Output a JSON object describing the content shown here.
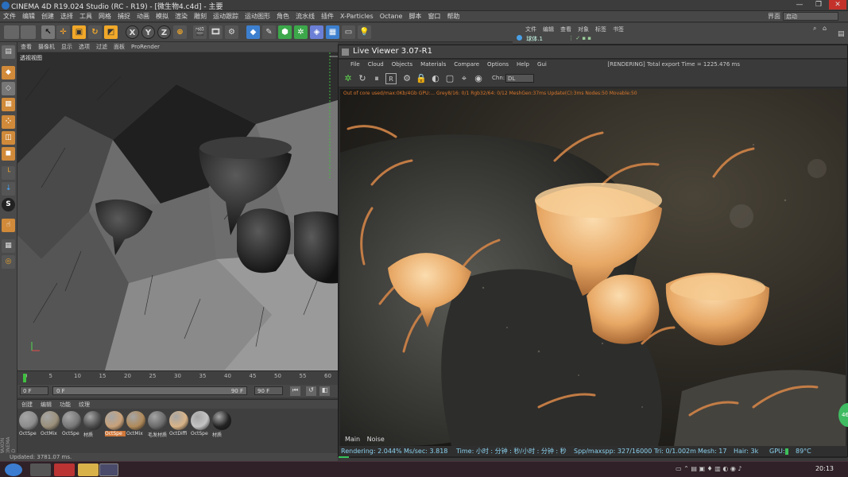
{
  "window": {
    "title": "CINEMA 4D R19.024 Studio (RC - R19) - [微生物4.c4d] - 主要"
  },
  "menu": [
    "文件",
    "编辑",
    "创建",
    "选择",
    "工具",
    "网格",
    "捕捉",
    "动画",
    "模拟",
    "渲染",
    "雕刻",
    "运动跟踪",
    "运动图形",
    "角色",
    "流水线",
    "插件",
    "X-Particles",
    "Octane",
    "脚本",
    "窗口",
    "帮助"
  ],
  "layout": {
    "label": "界面",
    "value": "启动"
  },
  "objmgr": {
    "menu": [
      "文件",
      "编辑",
      "查看",
      "对象",
      "标签",
      "书签"
    ],
    "object_name": "球体.1"
  },
  "viewport": {
    "menu": [
      "查看",
      "摄像机",
      "显示",
      "选项",
      "过滤",
      "面板",
      "ProRender"
    ],
    "label": "透视视图"
  },
  "timeline": {
    "ticks": [
      "0",
      "5",
      "10",
      "15",
      "20",
      "25",
      "30",
      "35",
      "40",
      "45",
      "50",
      "55",
      "60"
    ],
    "start_field": "0 F",
    "current_field": "0 F",
    "end_field": "90 F",
    "end_field2": "90 F"
  },
  "materials": {
    "menu": [
      "创建",
      "编辑",
      "功能",
      "纹理"
    ],
    "items": [
      {
        "label": "OctSpe",
        "color": "#8c8c8c",
        "selected": false
      },
      {
        "label": "OctMix",
        "color": "#9a8f7a",
        "selected": false
      },
      {
        "label": "OctSpe",
        "color": "#777777",
        "selected": false
      },
      {
        "label": "材质",
        "color": "#4a4a4a",
        "selected": false
      },
      {
        "label": "OctSpe",
        "color": "#c9a27a",
        "selected": true
      },
      {
        "label": "OctMix",
        "color": "#b08a5a",
        "selected": false
      },
      {
        "label": "毛发材质",
        "color": "#6a6a6a",
        "selected": false
      },
      {
        "label": "OctDiffi",
        "color": "#d9b488",
        "selected": false
      },
      {
        "label": "OctSpe",
        "color": "#c4c4c4",
        "selected": false
      },
      {
        "label": "材质",
        "color": "#222222",
        "selected": false
      }
    ]
  },
  "statusline": "Updated: 3781.07 ms.",
  "logo": "MAXON CINEMA 4D",
  "live_viewer": {
    "title": "Live Viewer 3.07-R1",
    "menu": [
      "File",
      "Cloud",
      "Objects",
      "Materials",
      "Compare",
      "Options",
      "Help",
      "Gui"
    ],
    "export_text": "[RENDERING] Total export Time = 1225.476 ms",
    "chn_label": "Chn:",
    "chn_value": "DL",
    "info_line": "Out of core used/max:0Kb/4Gb    GPU:...    Grey8/16: 0/1   Rgb32/64: 0/12   MeshGen:37ms   Update(C):3ms   Nodes:50   Movable:50",
    "tabs": [
      "Main",
      "Noise"
    ],
    "status": {
      "rendering": "Rendering: 2.044%",
      "ms_sec": "Ms/sec: 3.818",
      "time": "Time: 小时 : 分钟 : 秒/小时 : 分钟 : 秒",
      "spp": "Spp/maxspp: 327/16000",
      "tri": "Tri: 0/1.002m",
      "mesh": "Mesh: 17",
      "hair": "Hair: 3k",
      "gpu": "GPU:",
      "temp": "89°C"
    },
    "progress": 0.02044
  },
  "taskbar": {
    "clock": "20:13"
  },
  "notification": "46"
}
